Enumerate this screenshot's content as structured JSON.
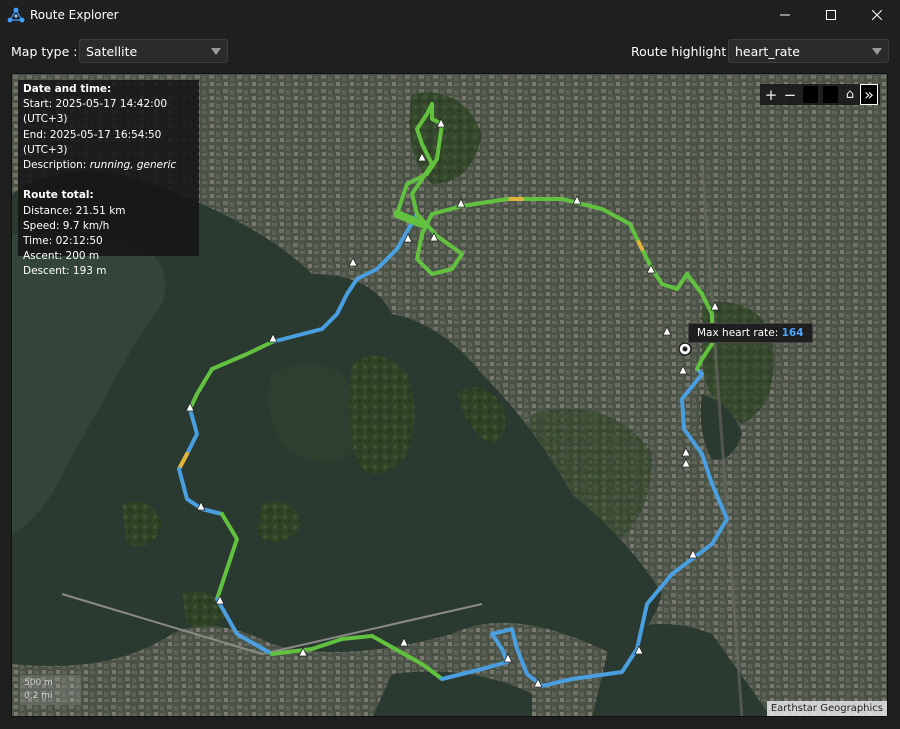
{
  "window": {
    "title": "Route Explorer",
    "app_icon": "route-explorer-logo"
  },
  "toolbar": {
    "map_type_label": "Map type :",
    "map_type_value": "Satellite",
    "route_highlight_label": "Route highlight :",
    "route_highlight_value": "heart_rate"
  },
  "info": {
    "date_heading": "Date and time:",
    "start_label": "Start:",
    "start_value": "2025-05-17 14:42:00 (UTC+3)",
    "end_label": "End:",
    "end_value": "2025-05-17 16:54:50 (UTC+3)",
    "description_label": "Description:",
    "description_value": "running, generic",
    "total_heading": "Route total:",
    "distance_label": "Distance:",
    "distance_value": "21.51 km",
    "speed_label": "Speed:",
    "speed_value": "9.7 km/h",
    "time_label": "Time:",
    "time_value": "02:12:50",
    "ascent_label": "Ascent:",
    "ascent_value": "200 m",
    "descent_label": "Descent:",
    "descent_value": "193 m"
  },
  "tooltip": {
    "label": "Max heart rate:",
    "value": "164"
  },
  "map_controls": {
    "zoom_in": "+",
    "zoom_out": "−",
    "home": "⌂",
    "collapse": "»"
  },
  "scale": {
    "metric": "500 m",
    "imperial": "0.2 mi"
  },
  "attribution": "Earthstar Geographics",
  "colors": {
    "route_low": "#4a9fe0",
    "route_mid": "#62c23f",
    "route_high": "#e0b43a",
    "background": "#1f1f1f",
    "accent_value": "#4aa3ff"
  }
}
